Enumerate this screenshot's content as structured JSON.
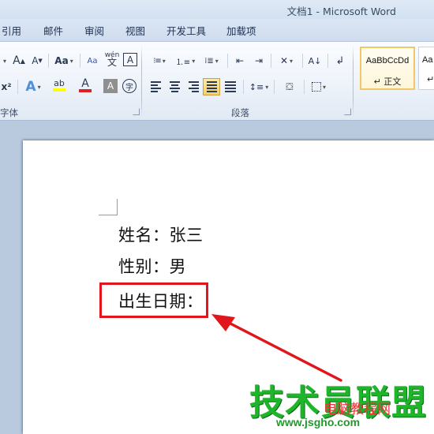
{
  "window": {
    "title": "文档1 - Microsoft Word"
  },
  "tabs": [
    "引用",
    "邮件",
    "审阅",
    "视图",
    "开发工具",
    "加载项"
  ],
  "ribbon": {
    "font_group": {
      "label": "字体",
      "grow_font": "A",
      "shrink_font": "A",
      "change_case": "Aa",
      "phonetic_guide": "wén",
      "char_border": "A",
      "superscript": "x²",
      "text_effects": "A",
      "highlight_color": "ab",
      "font_color": "A",
      "char_shading": "A",
      "enclose_char": "字"
    },
    "paragraph_group": {
      "label": "段落"
    },
    "styles_group": {
      "styles": [
        {
          "sample": "AaBbCcDd",
          "name": "↵ 正文",
          "selected": true
        },
        {
          "sample": "Aa",
          "name": "↵",
          "selected": false
        }
      ]
    }
  },
  "document": {
    "lines": [
      "姓名：张三",
      "性别：男",
      "出生日期："
    ],
    "annotation_color": "#e0161c"
  },
  "watermark": {
    "main": "技术员联盟",
    "sub": "电脑教程网",
    "url": "www.jsgho.com"
  }
}
